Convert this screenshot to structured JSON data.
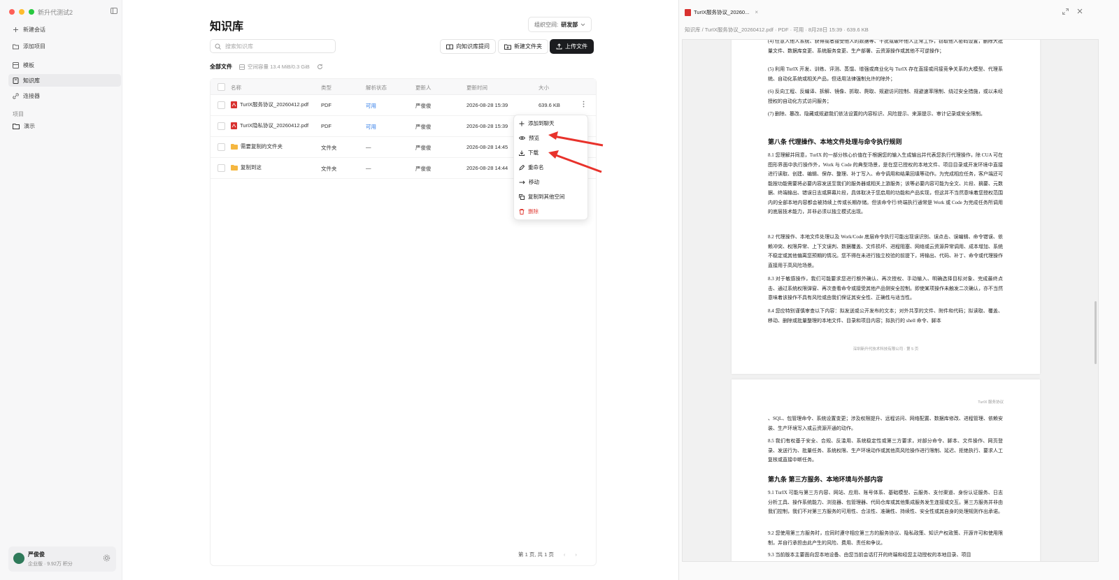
{
  "sidebar": {
    "workspace": "新升代测试2",
    "items": [
      {
        "label": "新建会话",
        "icon": "plus-icon"
      },
      {
        "label": "添加项目",
        "icon": "folder-add-icon"
      },
      {
        "label": "模板",
        "icon": "template-icon"
      },
      {
        "label": "知识库",
        "icon": "book-icon"
      },
      {
        "label": "连接器",
        "icon": "link-icon"
      }
    ],
    "section_label": "项目",
    "project": {
      "label": "演示",
      "icon": "folder-icon"
    },
    "user": {
      "name": "严俊俊",
      "sub": "企业版 · 9.92万 积分"
    }
  },
  "main": {
    "title": "知识库",
    "org_label": "组织空间:",
    "org_value": "研发部",
    "search_placeholder": "搜索知识库",
    "buttons": {
      "ask": "向知识库提问",
      "new_folder": "新建文件夹",
      "upload": "上传文件"
    },
    "tab_all": "全部文件",
    "capacity": "空间容量 13.4 MiB/0.3 GiB",
    "columns": [
      "名称",
      "类型",
      "解析状态",
      "更新人",
      "更新时间",
      "大小"
    ],
    "rows": [
      {
        "name": "TurIX服务协议_20260412.pdf",
        "type": "PDF",
        "status": "可用",
        "updater": "严俊俊",
        "time": "2026-08-28 15:39",
        "size": "639.6 KB"
      },
      {
        "name": "TurIX隐私协议_20260412.pdf",
        "type": "PDF",
        "status": "可用",
        "updater": "严俊俊",
        "time": "2026-08-28 15:39",
        "size": ""
      },
      {
        "name": "需要复制的文件夹",
        "type": "文件夹",
        "status": "—",
        "updater": "严俊俊",
        "time": "2026-08-28 14:45",
        "size": ""
      },
      {
        "name": "复制到这",
        "type": "文件夹",
        "status": "—",
        "updater": "严俊俊",
        "time": "2026-08-28 14:44",
        "size": ""
      }
    ],
    "pager": "第 1 页, 共 1 页"
  },
  "context_menu": [
    {
      "label": "添加到聊天",
      "icon": "plus-icon"
    },
    {
      "label": "预览",
      "icon": "eye-icon"
    },
    {
      "label": "下载",
      "icon": "download-icon"
    },
    {
      "label": "重命名",
      "icon": "pencil-icon"
    },
    {
      "label": "移动",
      "icon": "move-arrow-icon"
    },
    {
      "label": "复制到其他空间",
      "icon": "copy-icon"
    },
    {
      "label": "删除",
      "icon": "trash-icon"
    }
  ],
  "preview": {
    "tab_title": "TurIX服务协议_20260...",
    "meta": "知识库 / TurIX服务协议_20260412.pdf · PDF · 可用 · 8月28日 15:39 · 639.6 KB",
    "page1": {
      "p_top": "(4) 任意入他人系统、获得或者接受他人的数据等、干扰或破坏他人正常工作，窃取他人密码设置，删除大批量文件、数据库变更、系统服务变更、生产部署、云资源操作或其他不可逆操作；",
      "p5": "(5) 利用 TurIX 开发、训练、评测、蒸馏、增强或商业化与 TurIX 存在直接或间接竞争关系的大模型、代理系统、自动化系统或相关产品，但适用法律强制允许的除外；",
      "p6": "(6) 反向工程、反编译、拆解、镜像、抓取、爬取、规避访问控制、规避速率限制、绕过安全措施，或以未经授权的自动化方式访问服务；",
      "p7": "(7) 删除、篡改、隐藏或规避我们依法设置的内容标识、风险提示、来源提示、审计记录或安全限制。",
      "h8": "第八条 代理操作、本地文件处理与命令执行规则",
      "p81": "8.1 您理解并同意，TurIX 的一部分核心价值在于根据您的输入生成输出并代表您执行代理操作，除 CUA 可在图形界面中执行操作外，Work 与 Code 的典型场景，是在您已授权的本地文件、项目目录或开发环境中直接进行读取、创建、编辑、保存、整理、补丁写入、命令调用和结果回填等动作。为完成相应任务，客户端还可能按功能需要将必要内容发送至我们的服务器或相关上游服务；该等必要内容可能为全文、片段、摘要、元数据、终端输出、错误日志或屏幕片段，具体取决于您启用的功能和产品实现，但这并不当然意味着您授权范围内的全部本地内容都会被持续上传或长期存储。但该命令行/终端执行通常是 Work 或 Code 为完成任务所调用的底层技术能力，并非必须以独立模式出现。",
      "p82": "8.2 代理操作、本地文件处理以及 Work/Code 底层命令执行可能出现误识别、误点击、误编辑、命令错误、依赖冲突、权限异常、上下文误判、数据覆盖、文件损坏、进程阻塞、网络或云资源异常调用、成本增加、系统不稳定或其他偏离您预期的情况。您不得在未进行独立校验的前提下，将输出、代码、补丁、命令或代理操作直接用于高风险场景。",
      "p83": "8.3 对于敏感操作，我们可能要求您进行额外确认、再次授权、手动输入、明确选择目标对象、完成最终点击、通过系统权限弹窗、再次查看命令或接受其他产品侧安全控制。即使某项操作未触发二次确认，亦不当然意味着该操作不具有风险或由我们保证其安全性、正确性与适当性。",
      "p84": "8.4 您应特别谨慎审查以下内容：拟发送或公开发布的文本；对外共享的文件、附件和代码；拟读取、覆盖、移动、删除或批量整理的本地文件、目录和项目内容；拟执行的 shell 命令、脚本",
      "footer": "深圳新升代技术科技有限公司 · 第 5 页"
    },
    "page2": {
      "header": "TurIX 服务协议",
      "p_top": "、SQL、包管理命令、系统设置变更；涉及权限提升、远程访问、网络配置、数据库修改、进程管理、依赖安装、生产环境写入或云资源开通的动作。",
      "p85": "8.5 我们有权基于安全、合规、反滥用、系统稳定性或第三方要求，对部分命令、脚本、文件操作、网页登录、发送行为、批量任务、系统权限、生产环境动作或其他高风险操作进行限制、延迟、拒绝执行、要求人工复核或直接中断任务。",
      "h9": "第九条 第三方服务、本地环境与外部内容",
      "p91": "9.1 TurIX 可能与第三方内容、网站、应用、账号体系、基础模型、云服务、支付渠道、身份认证服务、日志分析工具、操作系统能力、浏览器、包管理器、代码仓库或其他集成服务发生连接或交互。第三方服务并非由我们控制，我们不对第三方服务的可用性、合法性、准确性、持续性、安全性或其自身的处理规则作出承诺。",
      "p92": "9.2 您使用第三方服务时，应同时遵守相应第三方的服务协议、隐私政策、知识产权政策、开源许可和使用限制，并自行承担由此产生的风险、费用、责任和争议。",
      "p93": "9.3 当前版本主要面向您本地设备、由您当前会话打开的终端和经您主动授权的本地目录、项目"
    }
  }
}
